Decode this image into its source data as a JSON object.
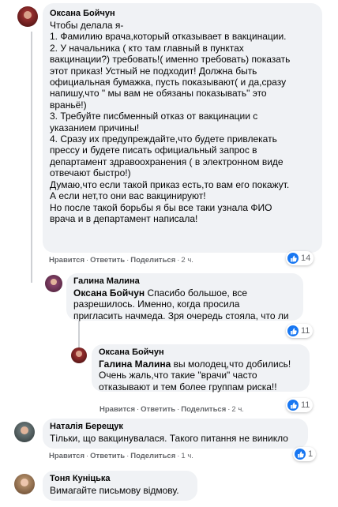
{
  "comments": [
    {
      "author": "Оксана Бойчун",
      "lines": [
        "Чтобы делала я-",
        "1. Фамилию врача,который отказывает в вакцинации.",
        "2. У начальника ( кто там главный в пунктах",
        "вакцинации?) требовать!( именно требовать) показать",
        "этот приказ! Устный не подходит! Должна быть",
        "официальная бумажка, пусть показывают( и да,сразу",
        "напишу,что \" мы вам не обязаны показывать\" это",
        "враньё!)",
        "3. Требуйте писбменный отказ от вакцинации с",
        "указанием причины!",
        "4. Сразу их предупреждайте,что будете привлекать",
        "прессу и будете писать официальный запрос в",
        "департамент здравоохранения ( в электронном виде",
        "отвечают быстро!)",
        "Думаю,что если такой приказ есть,то вам его покажут.",
        "А если нет,то они вас вакцинируют!",
        "Но после такой борьбы я бы все таки узнала ФИО",
        "врача и в департамент написала!"
      ],
      "actions": {
        "like": "Нравится",
        "reply": "Ответить",
        "share": "Поделиться",
        "time": "2 ч."
      },
      "reactions": "14"
    },
    {
      "author": "Галина Малина",
      "mention": "Оксана Бойчун",
      "first_line_rest": " Спасибо большое, все",
      "lines": [
        "разрешилось. Именно, когда просила",
        "пригласить начмеда. Зря очередь стояла, что ли"
      ],
      "reactions": "11"
    },
    {
      "author": "Оксана Бойчун",
      "mention": "Галина Малина",
      "first_line_rest": " вы молодец,что добились!",
      "lines": [
        "Очень жаль,что такие \"врачи\" часто",
        "отказывают и тем более группам риска!!"
      ],
      "actions": {
        "like": "Нравится",
        "reply": "Ответить",
        "share": "Поделиться",
        "time": "2 ч."
      },
      "reactions": "11"
    },
    {
      "author": "Наталія Берещук",
      "lines": [
        "Тільки, що вакцинувалася. Такого питання не виникло"
      ],
      "actions": {
        "like": "Нравится",
        "reply": "Ответить",
        "share": "Поделиться",
        "time": "1 ч."
      },
      "reactions": "1"
    },
    {
      "author": "Тоня Куніцька",
      "lines": [
        "Вимагайте письмову відмову."
      ]
    }
  ],
  "colors": {
    "bubble": "#f0f2f5",
    "like_blue": "#1877f2",
    "meta": "#65676b"
  },
  "icons": {
    "like": "thumbs-up-icon"
  }
}
